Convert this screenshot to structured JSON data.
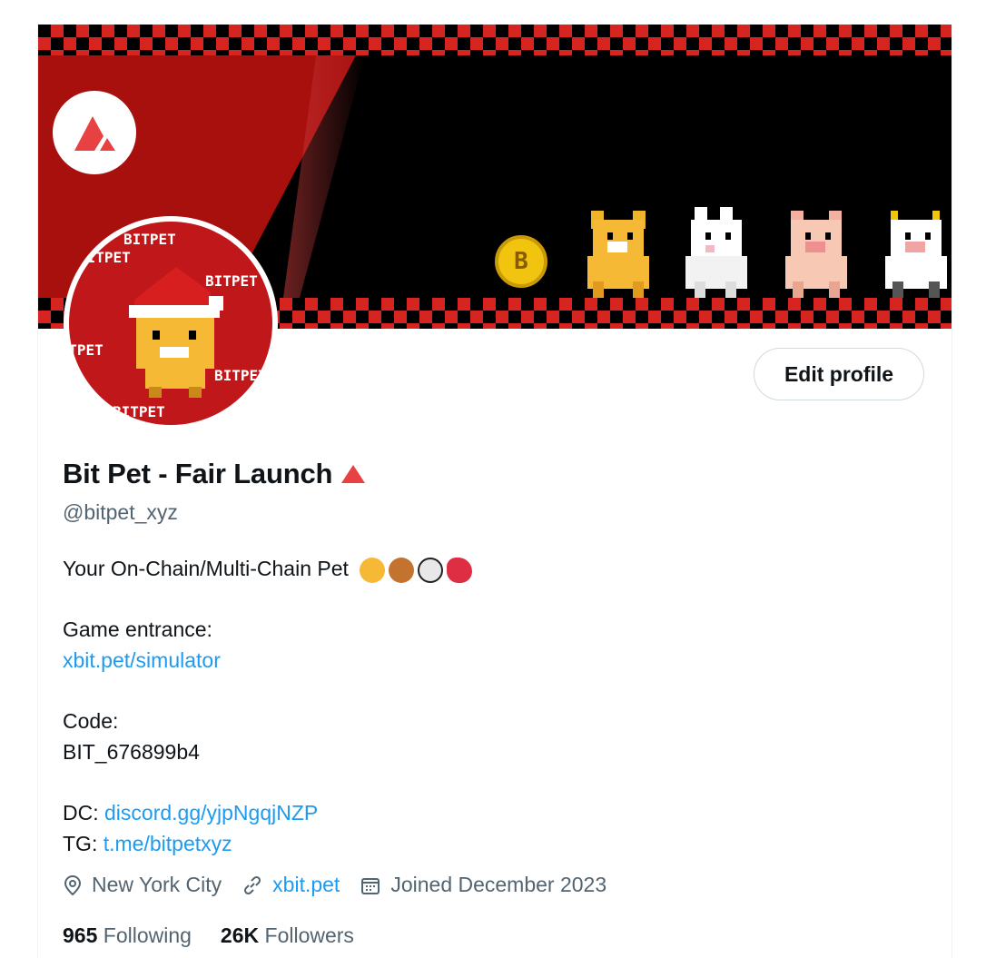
{
  "profile": {
    "edit_button_label": "Edit profile",
    "display_name": "Bit Pet - Fair Launch",
    "handle": "@bitpet_xyz",
    "bio": {
      "line1": "Your On-Chain/Multi-Chain Pet",
      "emojis": [
        "cat-face-emoji",
        "dog-face-emoji",
        "panda-face-emoji",
        "red-bird-emoji"
      ],
      "game_label": "Game entrance:",
      "game_link": "xbit.pet/simulator",
      "code_label": "Code:",
      "code_value": "BIT_676899b4",
      "dc_label": "DC:",
      "dc_link": "discord.gg/yjpNgqjNZP",
      "tg_label": "TG:",
      "tg_link": "t.me/bitpetxyz"
    },
    "location": "New York City",
    "website": "xbit.pet",
    "joined": "Joined December 2023",
    "following_count": "965",
    "following_label": "Following",
    "followers_count": "26K",
    "followers_label": "Followers"
  },
  "avatar": {
    "words": [
      "BITPET",
      "BITPET",
      "BITPET",
      "BITPET",
      "BITPET",
      "BITPET"
    ]
  },
  "banner": {
    "coin_letter": "B",
    "pets": [
      "shiba-dog",
      "rabbit",
      "pig",
      "cow"
    ]
  },
  "colors": {
    "link": "#1d9bf0",
    "secondary_text": "#536471",
    "avalanche_red": "#e84142",
    "banner_red": "#d62420"
  }
}
